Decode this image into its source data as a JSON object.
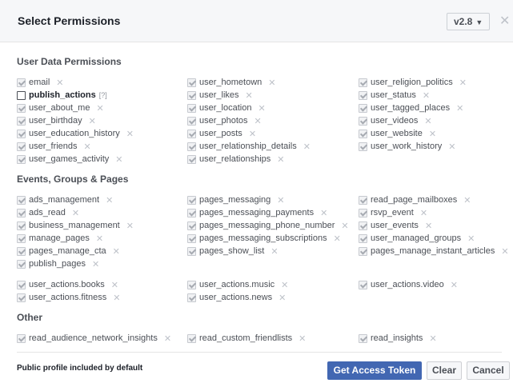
{
  "header": {
    "title": "Select Permissions",
    "version": "v2.8"
  },
  "sections": [
    {
      "title": "User Data Permissions",
      "groups": [
        [
          [
            {
              "label": "email",
              "checked": true
            },
            {
              "label": "publish_actions",
              "checked": false,
              "bold": true,
              "help": "[?]"
            },
            {
              "label": "user_about_me",
              "checked": true
            },
            {
              "label": "user_birthday",
              "checked": true
            },
            {
              "label": "user_education_history",
              "checked": true
            },
            {
              "label": "user_friends",
              "checked": true
            },
            {
              "label": "user_games_activity",
              "checked": true
            }
          ],
          [
            {
              "label": "user_hometown",
              "checked": true
            },
            {
              "label": "user_likes",
              "checked": true
            },
            {
              "label": "user_location",
              "checked": true
            },
            {
              "label": "user_photos",
              "checked": true
            },
            {
              "label": "user_posts",
              "checked": true
            },
            {
              "label": "user_relationship_details",
              "checked": true
            },
            {
              "label": "user_relationships",
              "checked": true
            }
          ],
          [
            {
              "label": "user_religion_politics",
              "checked": true
            },
            {
              "label": "user_status",
              "checked": true
            },
            {
              "label": "user_tagged_places",
              "checked": true
            },
            {
              "label": "user_videos",
              "checked": true
            },
            {
              "label": "user_website",
              "checked": true
            },
            {
              "label": "user_work_history",
              "checked": true
            }
          ]
        ]
      ]
    },
    {
      "title": "Events, Groups & Pages",
      "groups": [
        [
          [
            {
              "label": "ads_management",
              "checked": true
            },
            {
              "label": "ads_read",
              "checked": true
            },
            {
              "label": "business_management",
              "checked": true
            },
            {
              "label": "manage_pages",
              "checked": true
            },
            {
              "label": "pages_manage_cta",
              "checked": true
            },
            {
              "label": "publish_pages",
              "checked": true
            }
          ],
          [
            {
              "label": "pages_messaging",
              "checked": true
            },
            {
              "label": "pages_messaging_payments",
              "checked": true
            },
            {
              "label": "pages_messaging_phone_number",
              "checked": true
            },
            {
              "label": "pages_messaging_subscriptions",
              "checked": true
            },
            {
              "label": "pages_show_list",
              "checked": true
            }
          ],
          [
            {
              "label": "read_page_mailboxes",
              "checked": true
            },
            {
              "label": "rsvp_event",
              "checked": true
            },
            {
              "label": "user_events",
              "checked": true
            },
            {
              "label": "user_managed_groups",
              "checked": true
            },
            {
              "label": "pages_manage_instant_articles",
              "checked": true
            }
          ]
        ],
        [
          [
            {
              "label": "user_actions.books",
              "checked": true
            },
            {
              "label": "user_actions.fitness",
              "checked": true
            }
          ],
          [
            {
              "label": "user_actions.music",
              "checked": true
            },
            {
              "label": "user_actions.news",
              "checked": true
            }
          ],
          [
            {
              "label": "user_actions.video",
              "checked": true
            }
          ]
        ]
      ]
    },
    {
      "title": "Other",
      "groups": [
        [
          [
            {
              "label": "read_audience_network_insights",
              "checked": true
            }
          ],
          [
            {
              "label": "read_custom_friendlists",
              "checked": true
            }
          ],
          [
            {
              "label": "read_insights",
              "checked": true
            }
          ]
        ]
      ]
    }
  ],
  "footer": {
    "note": "Public profile included by default",
    "get_token": "Get Access Token",
    "clear": "Clear",
    "cancel": "Cancel"
  }
}
